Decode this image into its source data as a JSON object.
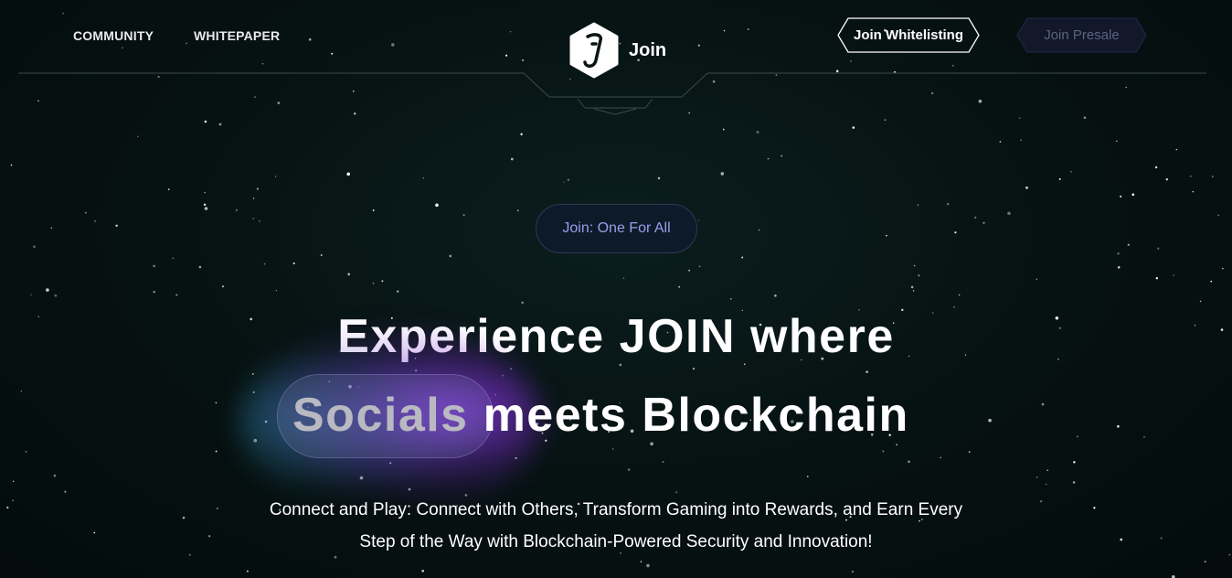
{
  "header": {
    "nav": [
      {
        "label": "COMMUNITY"
      },
      {
        "label": "WHITEPAPER"
      }
    ],
    "logo": {
      "icon": "join-logo-icon",
      "text": "Join"
    },
    "buttons": {
      "whitelist_label": "Join Whitelisting",
      "presale_label": "Join Presale"
    }
  },
  "hero": {
    "badge": "Join: One For All",
    "headline_line1": "Experience JOIN where",
    "headline_highlight": "Socials",
    "headline_line2_rest": "meets Blockchain",
    "subtitle_line1": "Connect and Play: Connect with Others, Transform Gaming into Rewards, and Earn Every",
    "subtitle_line2": "Step of the Way with Blockchain-Powered Security and Innovation!"
  },
  "colors": {
    "background": "#061111",
    "badge_text": "#9a9ee8",
    "presale_text": "#5d6280",
    "glow": "#9b3cff"
  }
}
